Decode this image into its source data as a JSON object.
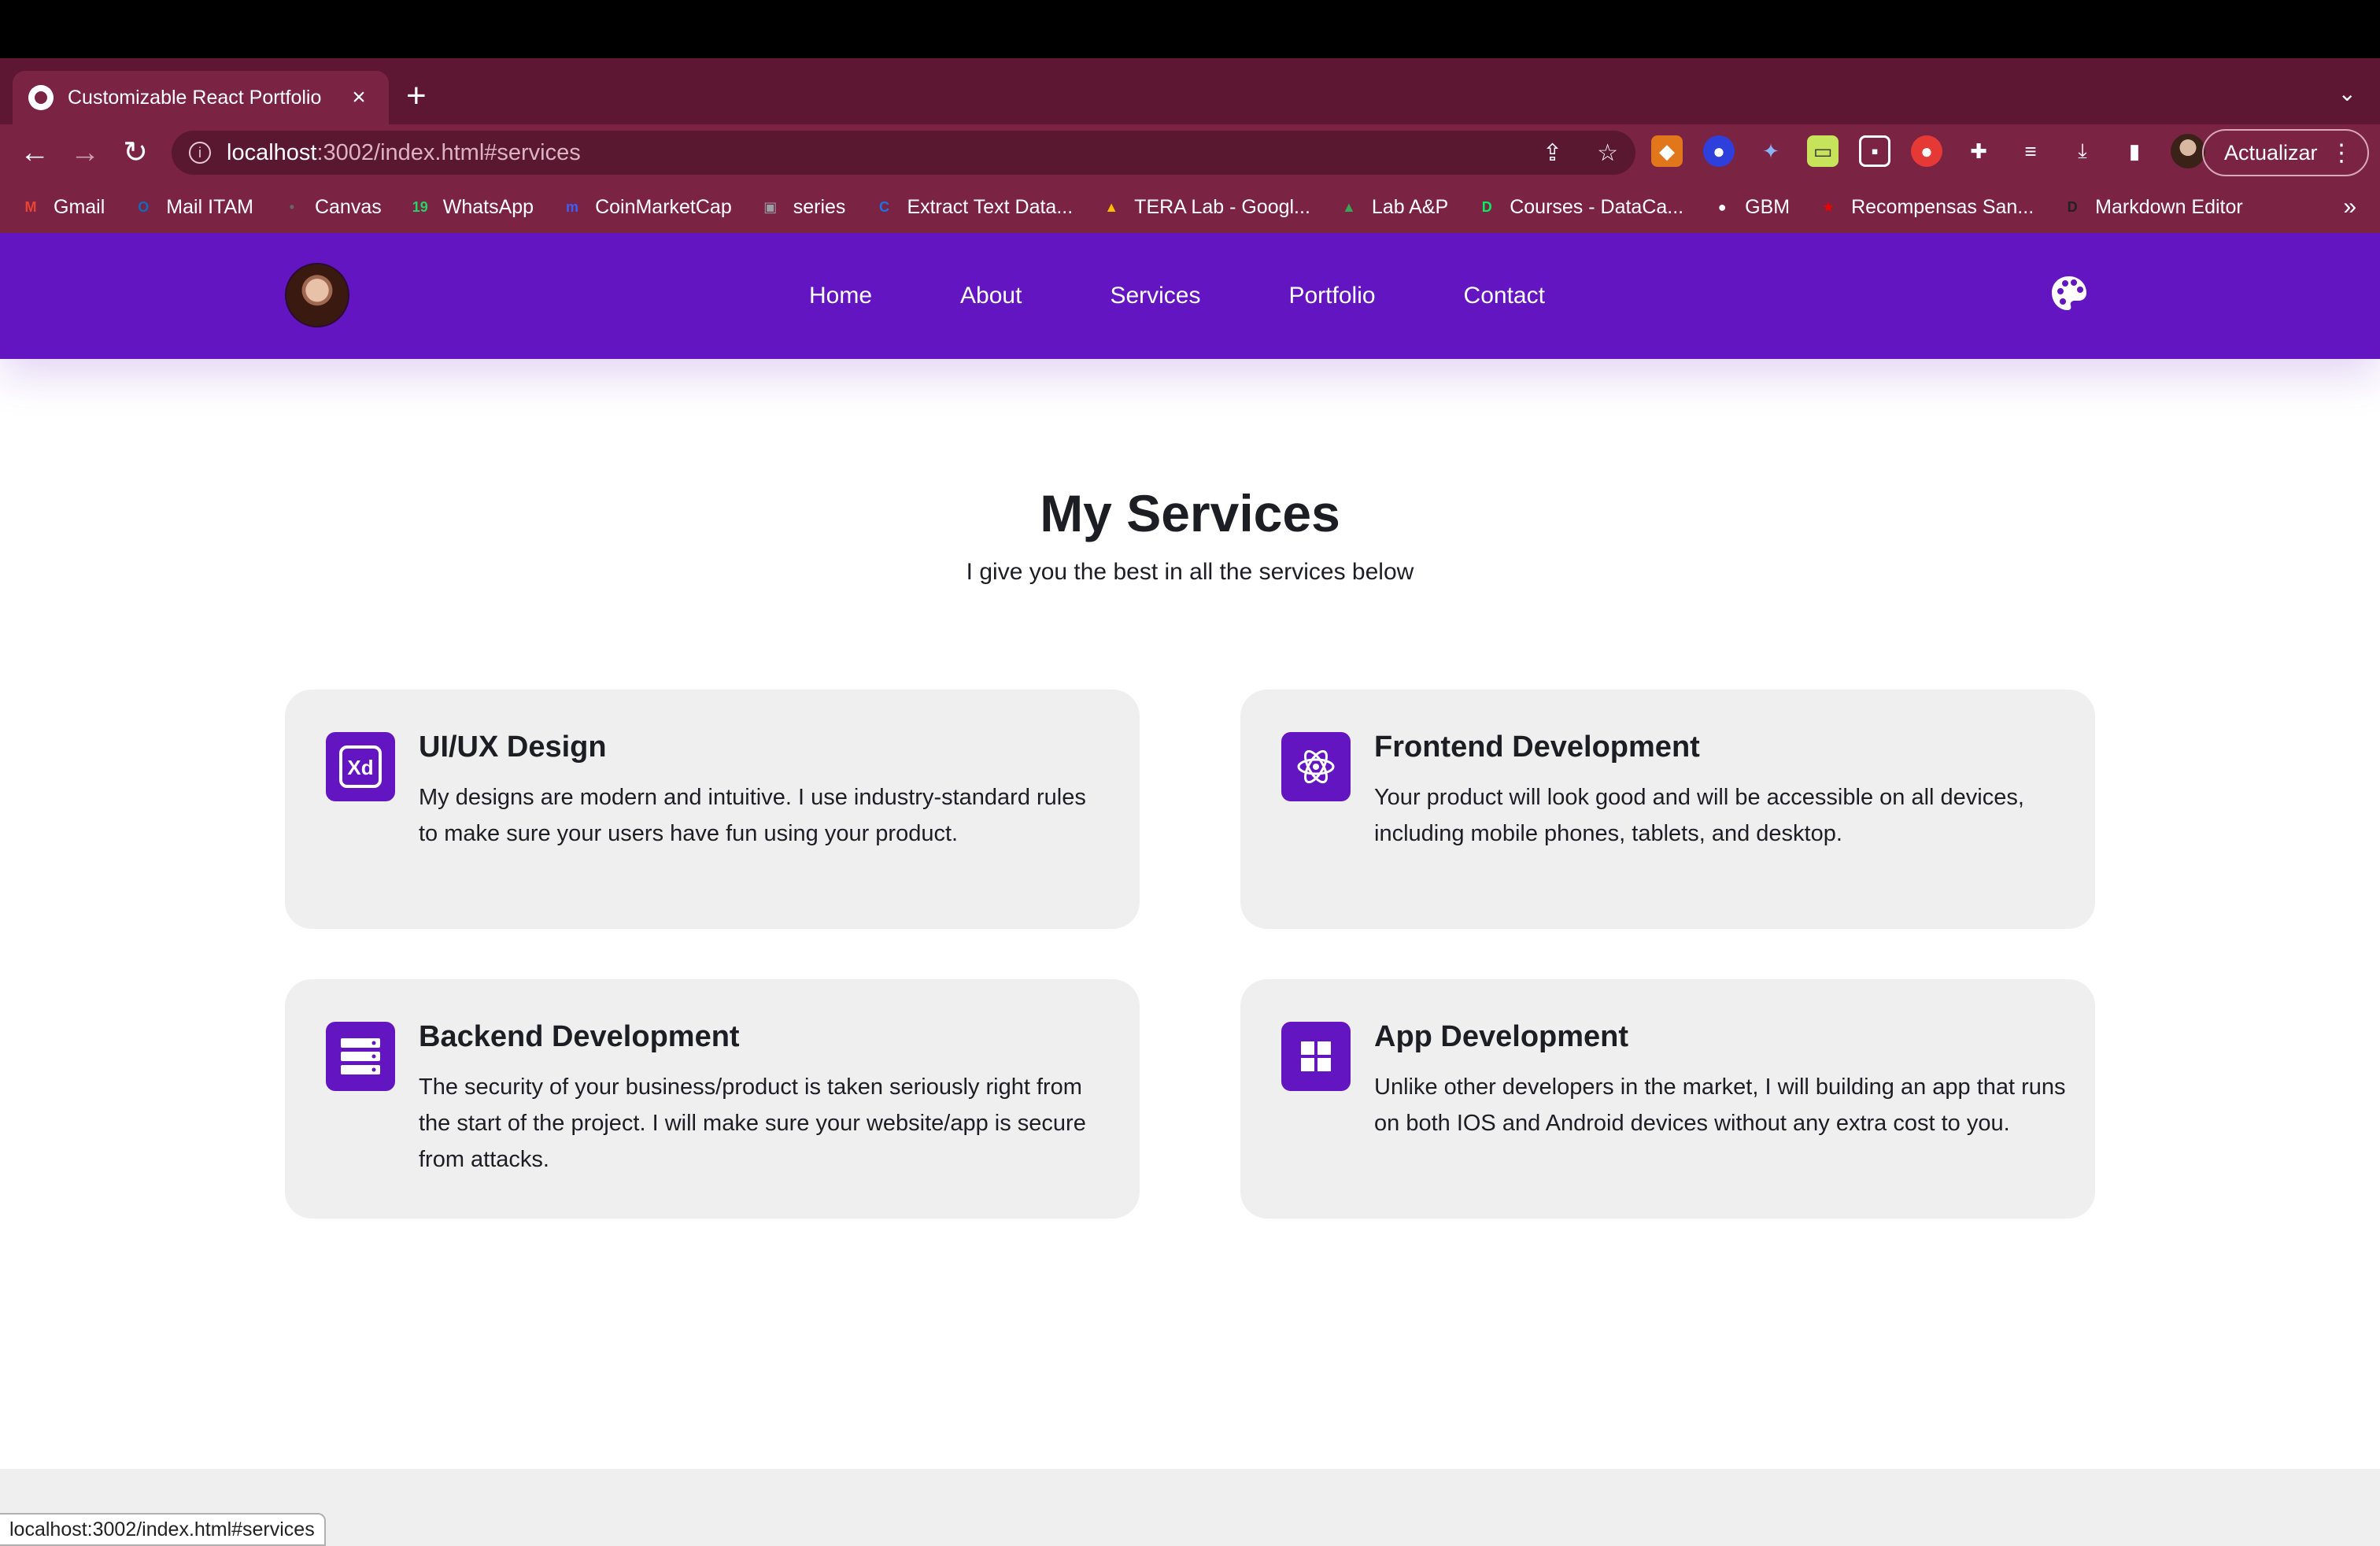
{
  "browser": {
    "tab_title": "Customizable React Portfolio",
    "tab_close": "×",
    "new_tab": "+",
    "url_host": "localhost",
    "url_path": ":3002/index.html#services",
    "update_label": "Actualizar",
    "status_url": "localhost:3002/index.html#services",
    "bookmarks": [
      {
        "label": "Gmail",
        "icon": "M",
        "color": "#ea4335"
      },
      {
        "label": "Mail ITAM",
        "icon": "O",
        "color": "#0f6cbd"
      },
      {
        "label": "Canvas",
        "icon": "•",
        "color": "#666666"
      },
      {
        "label": "WhatsApp",
        "icon": "19",
        "color": "#25d366"
      },
      {
        "label": "CoinMarketCap",
        "icon": "m",
        "color": "#3861fb"
      },
      {
        "label": "series",
        "icon": "▣",
        "color": "#9aa0a6"
      },
      {
        "label": "Extract Text Data...",
        "icon": "C",
        "color": "#1a73e8"
      },
      {
        "label": "TERA Lab - Googl...",
        "icon": "▲",
        "color": "#fbbc04"
      },
      {
        "label": "Lab A&P",
        "icon": "▲",
        "color": "#34a853"
      },
      {
        "label": "Courses - DataCa...",
        "icon": "D",
        "color": "#03ef62"
      },
      {
        "label": "GBM",
        "icon": "●",
        "color": "#ffffff"
      },
      {
        "label": "Recompensas San...",
        "icon": "★",
        "color": "#ec0000"
      },
      {
        "label": "Markdown Editor",
        "icon": "D",
        "color": "#222222"
      }
    ],
    "bookmarks_more": "»"
  },
  "navbar": {
    "items": [
      "Home",
      "About",
      "Services",
      "Portfolio",
      "Contact"
    ],
    "accent": "#6215c1"
  },
  "services": {
    "title": "My Services",
    "subtitle": "I give you the best in all the services below",
    "cards": [
      {
        "icon": "adobe-xd-icon",
        "title": "UI/UX Design",
        "text": "My designs are modern and intuitive. I use industry-standard rules to make sure your users have fun using your product."
      },
      {
        "icon": "react-atom-icon",
        "title": "Frontend Development",
        "text": "Your product will look good and will be accessible on all devices, including mobile phones, tablets, and desktop."
      },
      {
        "icon": "server-icon",
        "title": "Backend Development",
        "text": "The security of your business/product is taken seriously right from the start of the project. I will make sure your website/app is secure from attacks."
      },
      {
        "icon": "apps-grid-icon",
        "title": "App Development",
        "text": "Unlike other developers in the market, I will building an app that runs on both IOS and Android devices without any extra cost to you."
      }
    ]
  }
}
